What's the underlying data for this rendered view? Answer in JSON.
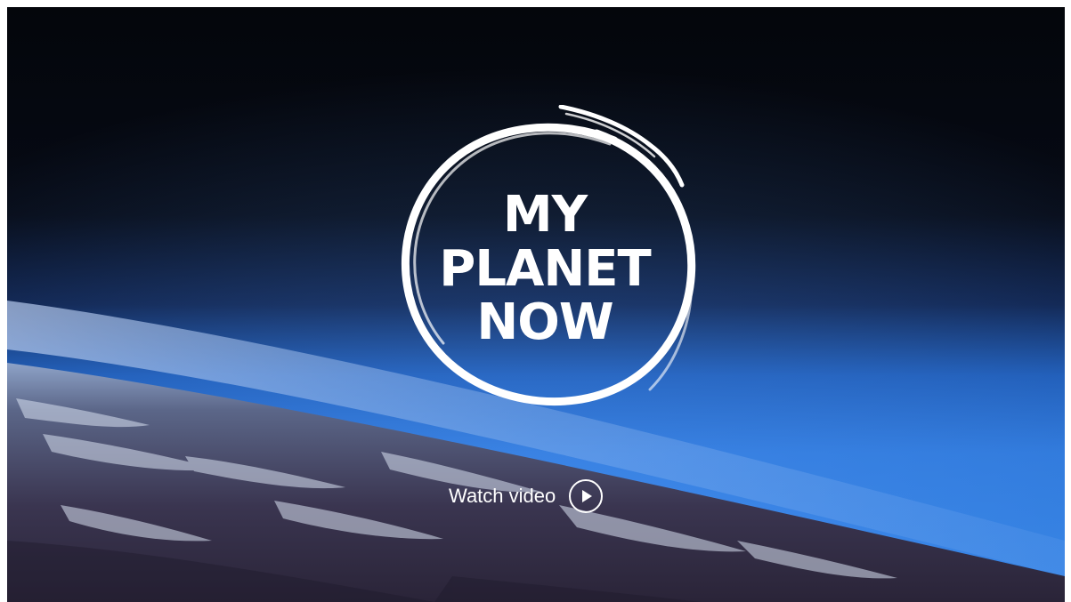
{
  "hero": {
    "logo": {
      "line_1": "MY",
      "line_2": "PLANET",
      "line_3": "NOW"
    },
    "cta": {
      "label": "Watch video",
      "icon": "play-circle-icon"
    }
  },
  "colors": {
    "space": "#05070d",
    "atmosphere": "#1f5fc2",
    "text": "#ffffff"
  }
}
